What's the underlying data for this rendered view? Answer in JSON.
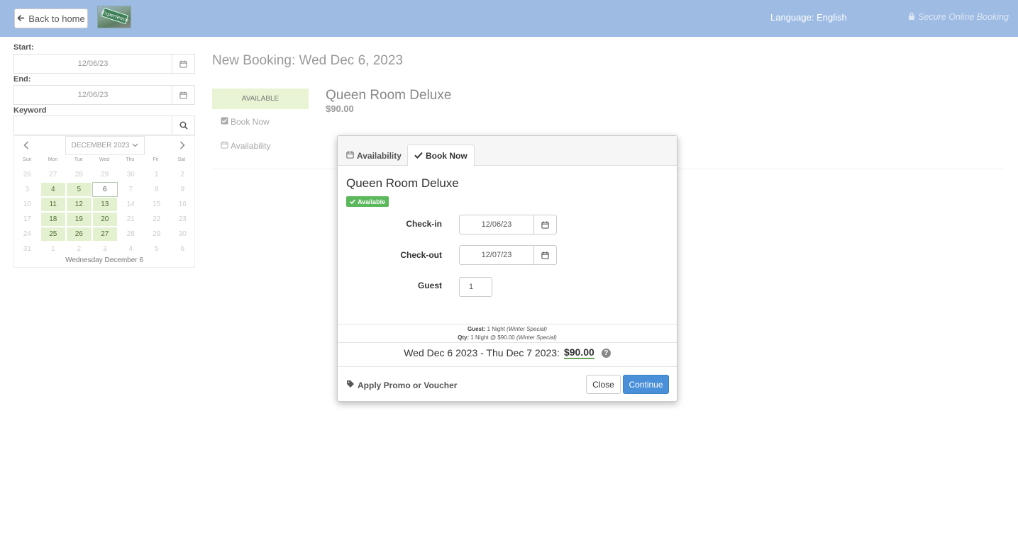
{
  "header": {
    "back_label": "Back to home",
    "logo_text": "Experience",
    "language_label": "Language: English",
    "secure_label": "Secure Online Booking"
  },
  "sidebar": {
    "start_label": "Start:",
    "start_value": "12/06/23",
    "end_label": "End:",
    "end_value": "12/06/23",
    "keyword_label": "Keyword",
    "keyword_value": "",
    "calendar": {
      "month": "DECEMBER 2023",
      "weekdays": [
        "Sun",
        "Mon",
        "Tue",
        "Wed",
        "Thu",
        "Fri",
        "Sat"
      ],
      "days": [
        {
          "d": "26",
          "s": "muted"
        },
        {
          "d": "27",
          "s": "muted"
        },
        {
          "d": "28",
          "s": "muted"
        },
        {
          "d": "29",
          "s": "muted"
        },
        {
          "d": "30",
          "s": "muted"
        },
        {
          "d": "1",
          "s": "muted"
        },
        {
          "d": "2",
          "s": "muted"
        },
        {
          "d": "3",
          "s": "muted"
        },
        {
          "d": "4",
          "s": "avail"
        },
        {
          "d": "5",
          "s": "avail"
        },
        {
          "d": "6",
          "s": "selected"
        },
        {
          "d": "7",
          "s": "muted"
        },
        {
          "d": "8",
          "s": "muted"
        },
        {
          "d": "9",
          "s": "muted"
        },
        {
          "d": "10",
          "s": "muted"
        },
        {
          "d": "11",
          "s": "avail"
        },
        {
          "d": "12",
          "s": "avail"
        },
        {
          "d": "13",
          "s": "avail"
        },
        {
          "d": "14",
          "s": "muted"
        },
        {
          "d": "15",
          "s": "muted"
        },
        {
          "d": "16",
          "s": "muted"
        },
        {
          "d": "17",
          "s": "muted"
        },
        {
          "d": "18",
          "s": "avail"
        },
        {
          "d": "19",
          "s": "avail"
        },
        {
          "d": "20",
          "s": "avail"
        },
        {
          "d": "21",
          "s": "muted"
        },
        {
          "d": "22",
          "s": "muted"
        },
        {
          "d": "23",
          "s": "muted"
        },
        {
          "d": "24",
          "s": "muted"
        },
        {
          "d": "25",
          "s": "avail"
        },
        {
          "d": "26",
          "s": "avail"
        },
        {
          "d": "27",
          "s": "avail"
        },
        {
          "d": "28",
          "s": "muted"
        },
        {
          "d": "29",
          "s": "muted"
        },
        {
          "d": "30",
          "s": "muted"
        },
        {
          "d": "31",
          "s": "muted"
        },
        {
          "d": "1",
          "s": "muted"
        },
        {
          "d": "2",
          "s": "muted"
        },
        {
          "d": "3",
          "s": "muted"
        },
        {
          "d": "4",
          "s": "muted"
        },
        {
          "d": "5",
          "s": "muted"
        },
        {
          "d": "6",
          "s": "muted"
        }
      ],
      "footer": "Wednesday December 6"
    }
  },
  "main": {
    "title": "New Booking: Wed Dec 6, 2023",
    "status": "AVAILABLE",
    "book_now_link": "Book Now",
    "availability_link": "Availability",
    "room_name": "Queen Room Deluxe",
    "room_price": "$90.00"
  },
  "modal": {
    "tab_availability": "Availability",
    "tab_book_now": "Book Now",
    "room_name": "Queen Room Deluxe",
    "badge": "Available",
    "checkin_label": "Check-in",
    "checkin_value": "12/06/23",
    "checkout_label": "Check-out",
    "checkout_value": "12/07/23",
    "guest_label": "Guest",
    "guest_value": "1",
    "note1_label": "Guest:",
    "note1_text": "1 Night",
    "note1_special": "(Winter Special)",
    "note2_label": "Qty:",
    "note2_text": "1 Night @ $90.00",
    "note2_special": "(Winter Special)",
    "total_range": "Wed Dec 6 2023 - Thu Dec 7 2023:",
    "total_price": "$90.00",
    "help_symbol": "?",
    "promo_label": "Apply Promo or Voucher",
    "close_label": "Close",
    "continue_label": "Continue"
  },
  "colors": {
    "topbar": "#9dbbe3",
    "available_bg": "#e3f1d1",
    "badge_green": "#5cb85c",
    "primary_button": "#4a90d9"
  }
}
